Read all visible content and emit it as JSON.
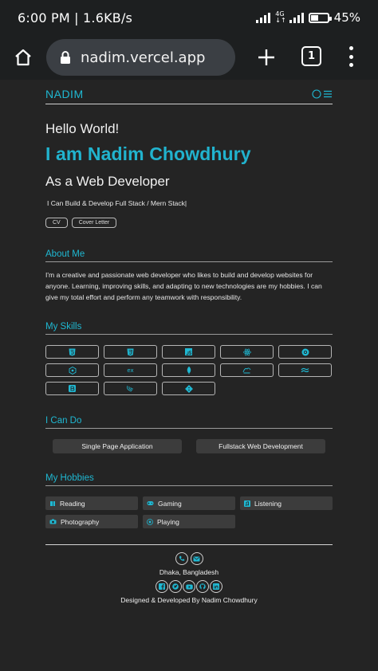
{
  "status_bar": {
    "time": "6:00 PM | 1.6KB/s",
    "network": "4G",
    "battery_percent": 45,
    "battery_label": "45%"
  },
  "browser": {
    "url": "nadim.vercel.app",
    "tab_count": "1",
    "icons": [
      "home-icon",
      "lock-icon",
      "plus-icon",
      "tabs-icon",
      "more-vert-icon"
    ]
  },
  "colors": {
    "accent": "#1fb8d2",
    "background": "#242424",
    "chip_bg": "#3c3c3c"
  },
  "navbar": {
    "brand": "NADIM",
    "icons": [
      "theme-toggle-icon",
      "hamburger-icon"
    ]
  },
  "hero": {
    "greeting": "Hello World!",
    "name": "I am Nadim Chowdhury",
    "role": "As a Web Developer",
    "typed_text": "I Can Build & Develop Full Stack / Mern Stack|",
    "buttons": [
      "CV",
      "Cover Letter"
    ]
  },
  "about": {
    "title": "About Me",
    "text": "I'm a creative and passionate web developer who likes to build and develop websites for anyone. Learning, improving skills, and adapting to new technologies are my hobbies. I can give my total effort and perform any teamwork with responsibility."
  },
  "skills": {
    "title": "My Skills",
    "items": [
      {
        "icon": "html5-icon"
      },
      {
        "icon": "css3-icon"
      },
      {
        "icon": "javascript-icon"
      },
      {
        "icon": "react-icon"
      },
      {
        "icon": "redux-icon"
      },
      {
        "icon": "nodejs-icon"
      },
      {
        "icon": "express-icon"
      },
      {
        "icon": "mongodb-icon"
      },
      {
        "icon": "firebase-icon"
      },
      {
        "icon": "tailwind-icon"
      },
      {
        "icon": "bootstrap-icon"
      },
      {
        "icon": "jquery-icon"
      },
      {
        "icon": "git-icon"
      }
    ]
  },
  "can_do": {
    "title": "I Can Do",
    "items": [
      "Single Page Application",
      "Fullstack Web Development"
    ]
  },
  "hobbies": {
    "title": "My Hobbies",
    "items": [
      {
        "label": "Reading",
        "icon": "book-icon"
      },
      {
        "label": "Gaming",
        "icon": "gamepad-icon"
      },
      {
        "label": "Listening",
        "icon": "music-icon"
      },
      {
        "label": "Photography",
        "icon": "camera-icon"
      },
      {
        "label": "Playing",
        "icon": "ball-icon"
      }
    ]
  },
  "footer": {
    "contact_icons": [
      "phone-icon",
      "email-icon"
    ],
    "location": "Dhaka, Bangladesh",
    "social_icons": [
      "facebook-icon",
      "twitter-icon",
      "youtube-icon",
      "github-icon",
      "linkedin-icon"
    ],
    "credit": "Designed & Developed By Nadim Chowdhury"
  }
}
